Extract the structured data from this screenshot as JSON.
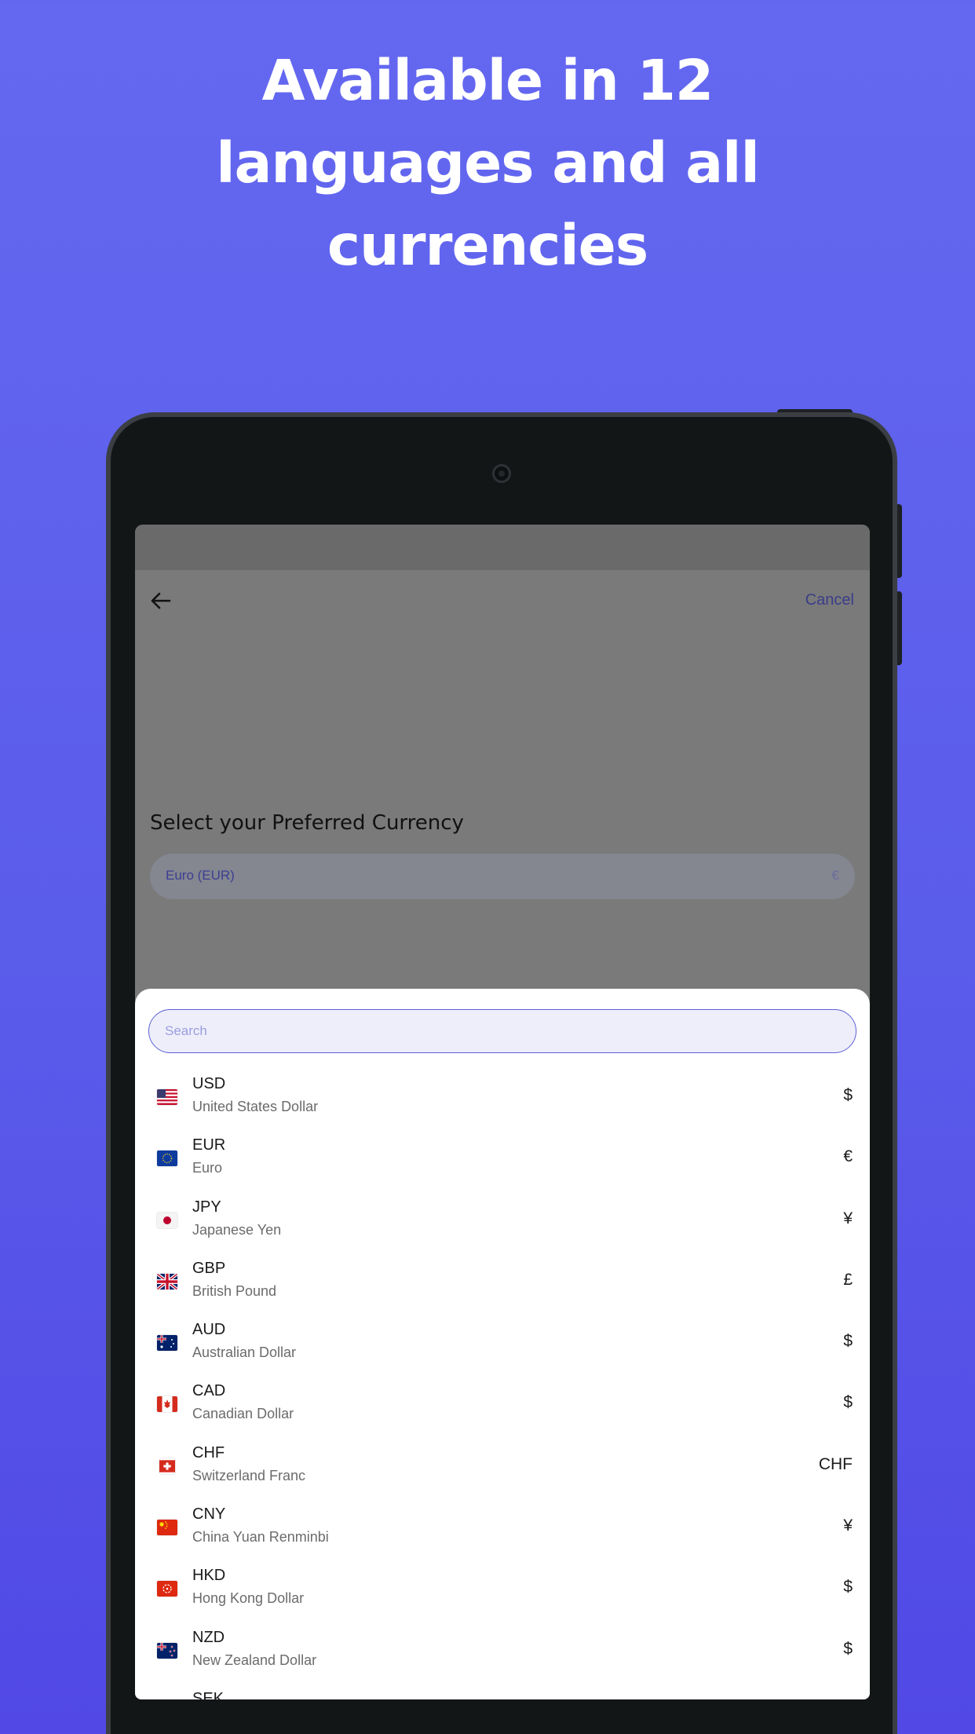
{
  "headline": {
    "line1": "Available in 12",
    "line2": "languages and all",
    "line3": "currencies"
  },
  "header": {
    "back_icon": "arrow-left-icon",
    "cancel_label": "Cancel"
  },
  "section": {
    "title": "Select your Preferred Currency",
    "selected_value": "Euro (EUR)",
    "selected_symbol": "€"
  },
  "sheet": {
    "search_placeholder": "Search",
    "currencies": [
      {
        "code": "USD",
        "name": "United States Dollar",
        "symbol": "$",
        "flag": "us-flag-icon"
      },
      {
        "code": "EUR",
        "name": "Euro",
        "symbol": "€",
        "flag": "eu-flag-icon"
      },
      {
        "code": "JPY",
        "name": "Japanese Yen",
        "symbol": "¥",
        "flag": "jp-flag-icon"
      },
      {
        "code": "GBP",
        "name": "British Pound",
        "symbol": "£",
        "flag": "gb-flag-icon"
      },
      {
        "code": "AUD",
        "name": "Australian Dollar",
        "symbol": "$",
        "flag": "au-flag-icon"
      },
      {
        "code": "CAD",
        "name": "Canadian Dollar",
        "symbol": "$",
        "flag": "ca-flag-icon"
      },
      {
        "code": "CHF",
        "name": "Switzerland Franc",
        "symbol": "CHF",
        "flag": "ch-flag-icon"
      },
      {
        "code": "CNY",
        "name": "China Yuan Renminbi",
        "symbol": "¥",
        "flag": "cn-flag-icon"
      },
      {
        "code": "HKD",
        "name": "Hong Kong Dollar",
        "symbol": "$",
        "flag": "hk-flag-icon"
      },
      {
        "code": "NZD",
        "name": "New Zealand Dollar",
        "symbol": "$",
        "flag": "nz-flag-icon"
      },
      {
        "code": "SEK",
        "name": "",
        "symbol": "",
        "flag": "se-flag-icon"
      }
    ]
  },
  "colors": {
    "background": "#6468f0",
    "accent": "#5b5fd6",
    "device_bezel": "#131617"
  }
}
